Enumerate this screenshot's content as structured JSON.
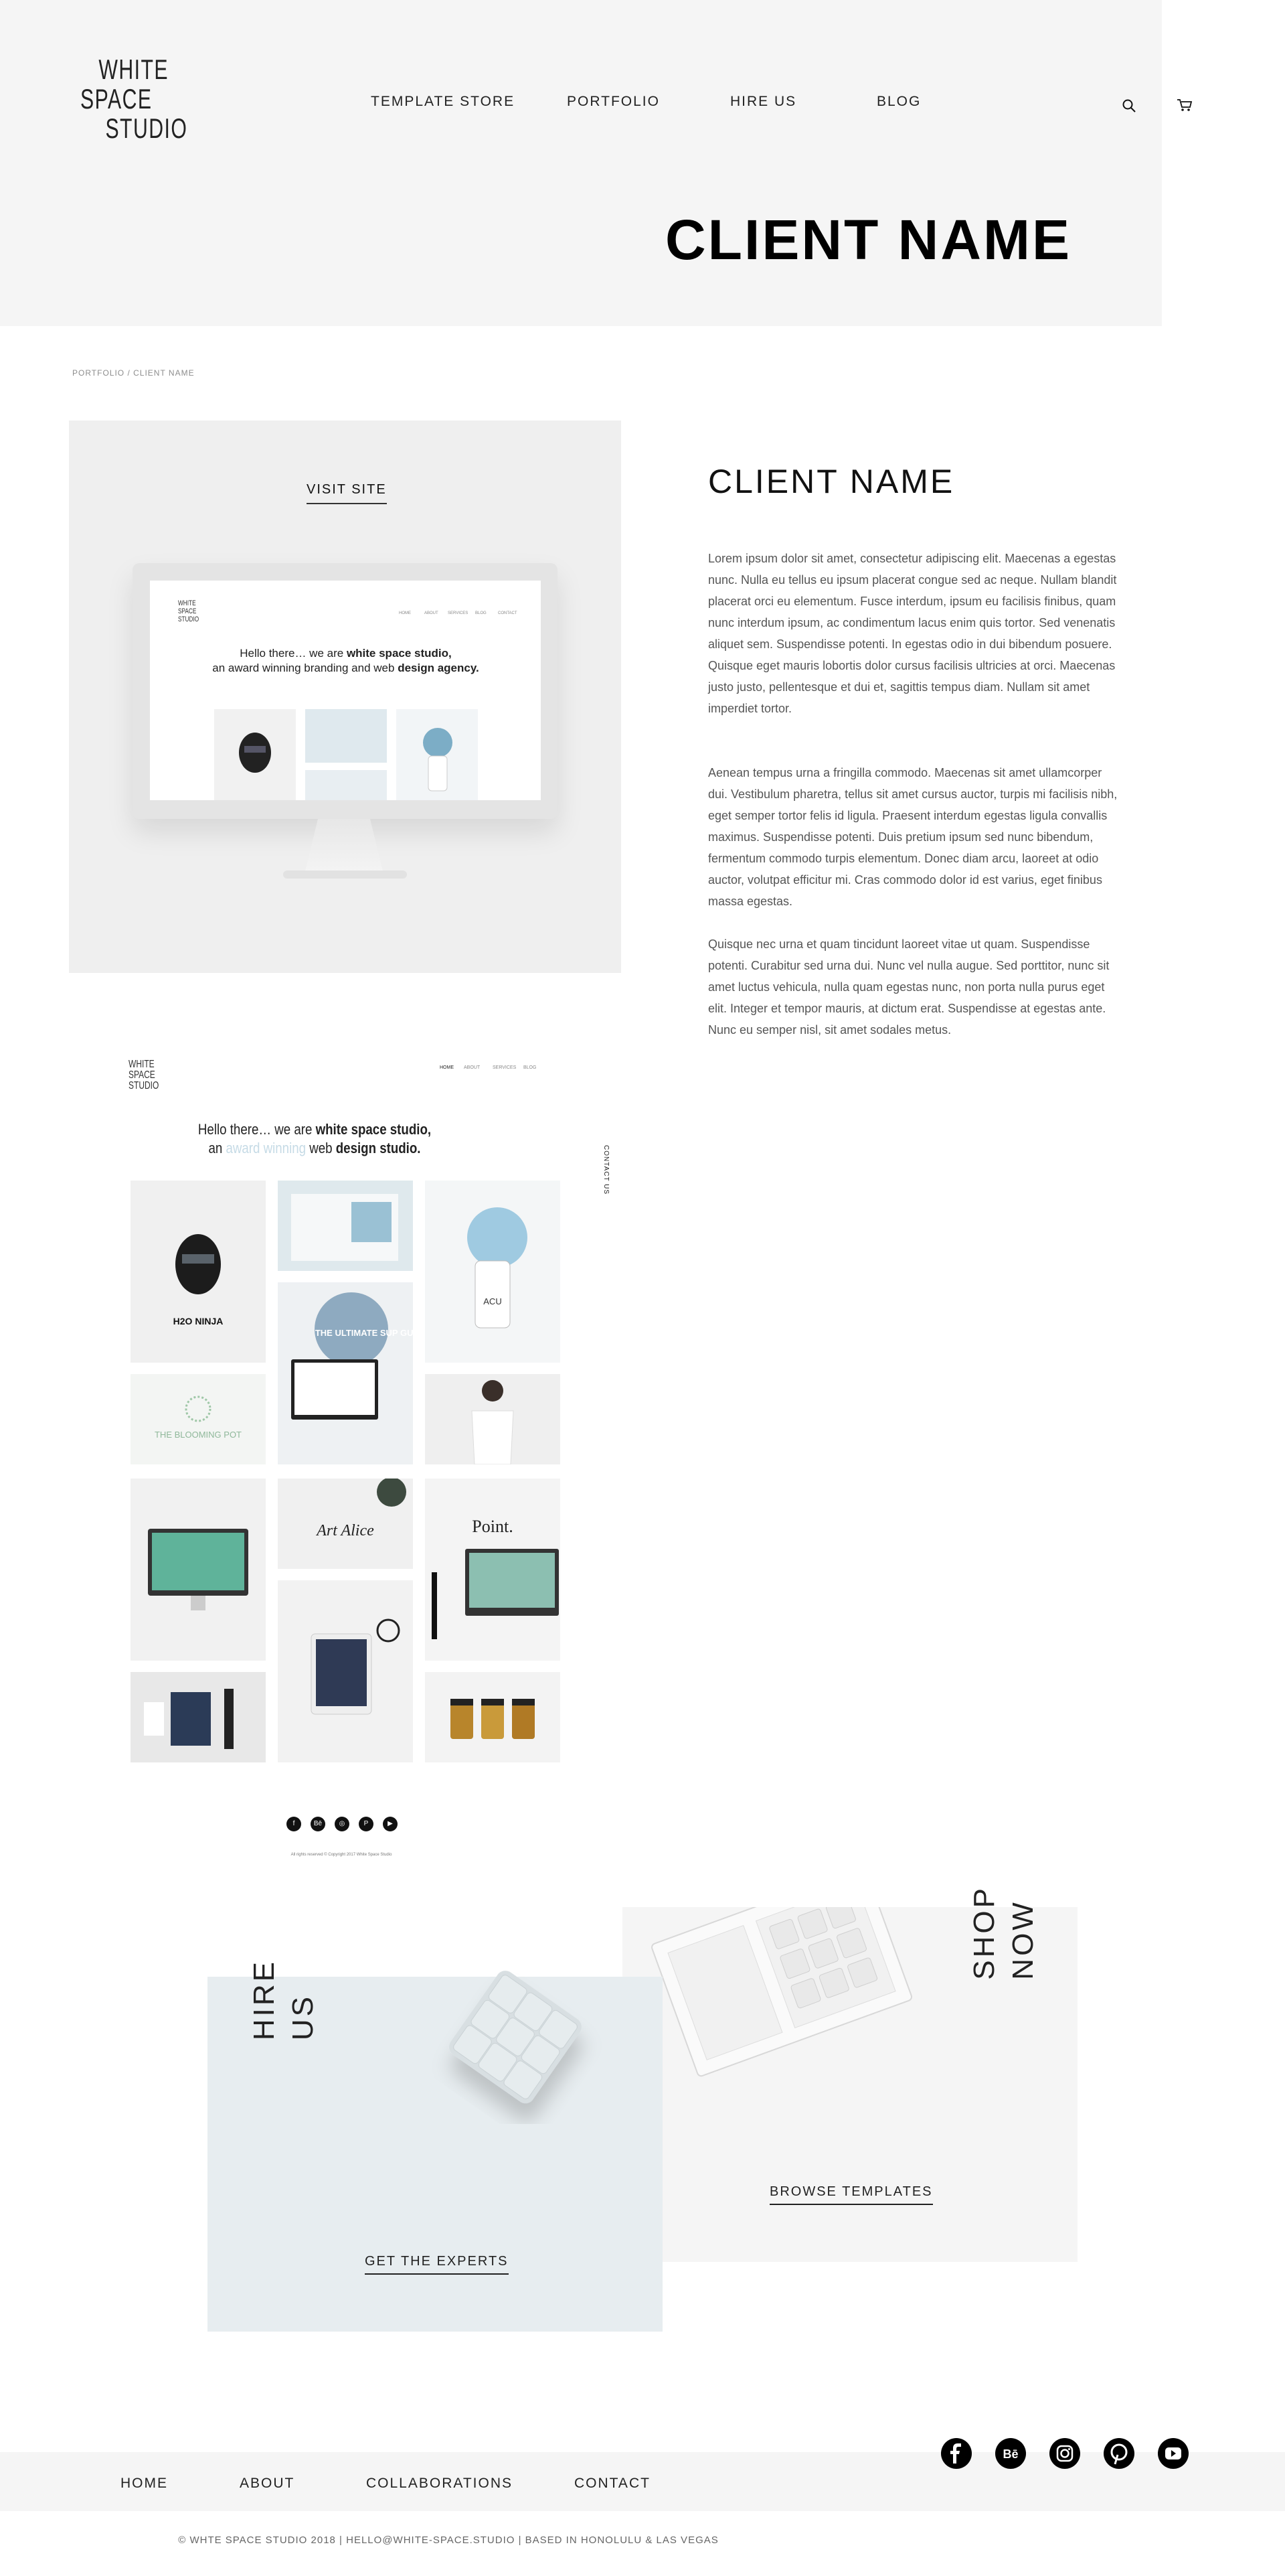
{
  "brand": {
    "logo_line1": "WHITE",
    "logo_line2": "SPACE",
    "logo_line3": "STUDIO"
  },
  "nav": [
    "TEMPLATE STORE",
    "PORTFOLIO",
    "HIRE US",
    "BLOG"
  ],
  "header_icons": [
    "search-icon",
    "cart-icon"
  ],
  "hero": {
    "title": "CLIENT NAME"
  },
  "breadcrumb": "PORTFOLIO / CLIENT NAME",
  "showcase": {
    "visit_label": "VISIT SITE",
    "screen_hello": "Hello there… we are",
    "screen_studio": "white space studio,",
    "screen_tagline1": "an award winning branding and web",
    "screen_tagline2": "design agency.",
    "screen_nav": [
      "HOME",
      "ABOUT",
      "SERVICES",
      "BLOG",
      "CONTACT"
    ]
  },
  "client": {
    "heading": "CLIENT NAME",
    "paragraphs": [
      "Lorem ipsum dolor sit amet, consectetur adipiscing elit. Maecenas a egestas nunc. Nulla eu tellus eu ipsum placerat congue sed ac neque. Nullam blandit placerat orci eu elementum. Fusce interdum, ipsum eu facilisis finibus, quam nunc interdum ipsum, ac condimentum lacus enim quis tortor. Sed venenatis aliquet sem. Suspendisse potenti. In egestas odio in dui bibendum posuere. Quisque eget mauris lobortis dolor cursus facilisis ultricies at orci. Maecenas justo justo, pellentesque et dui et, sagittis tempus diam. Nullam sit amet imperdiet tortor.",
      "Aenean tempus urna a fringilla commodo. Maecenas sit amet ullamcorper dui. Vestibulum pharetra, tellus sit amet cursus auctor, turpis mi facilisis nibh, eget semper tortor felis id ligula. Praesent interdum egestas ligula convallis maximus. Suspendisse potenti. Duis pretium ipsum sed nunc bibendum, fermentum commodo turpis elementum. Donec diam arcu, laoreet at odio auctor, volutpat efficitur mi. Cras commodo dolor id est varius, eget finibus massa egestas.",
      "Quisque nec urna et quam tincidunt laoreet vitae ut quam. Suspendisse potenti. Curabitur sed urna dui. Nunc vel nulla augue. Sed porttitor, nunc sit amet luctus vehicula, nulla quam egestas nunc, non porta nulla purus eget elit. Integer et tempor mauris, at dictum erat. Suspendisse at egestas ante. Nunc eu semper nisl, sit amet sodales metus."
    ]
  },
  "preview": {
    "hello_line1": "Hello there… we are",
    "studio": "white space studio,",
    "an": "an",
    "award": "award winning",
    "web": "web",
    "design": "design studio.",
    "contact_tab": "CONTACT US",
    "nav": [
      "HOME",
      "ABOUT",
      "SERVICES",
      "BLOG"
    ],
    "tiles": [
      "H2O NINJA",
      "THE ULTIMATE SUP GUIDE",
      "ACU",
      "THE BLOOMING POT",
      "Art Alice",
      "Point."
    ],
    "rights": "All rights reserved © Copyright 2017 White Space Studio"
  },
  "cards": {
    "hire_title_1": "HIRE",
    "hire_title_2": "US",
    "hire_cta": "GET THE EXPERTS",
    "shop_title_1": "SHOP",
    "shop_title_2": "NOW",
    "shop_cta": "BROWSE TEMPLATES"
  },
  "footer": {
    "nav": [
      "HOME",
      "ABOUT",
      "COLLABORATIONS",
      "CONTACT"
    ],
    "social": [
      "facebook-icon",
      "behance-icon",
      "instagram-icon",
      "pinterest-icon",
      "youtube-icon"
    ],
    "copyright": "© WHTE SPACE STUDIO 2018 |  HELLO@WHITE-SPACE.STUDIO |   BASED IN HONOLULU & LAS VEGAS"
  }
}
